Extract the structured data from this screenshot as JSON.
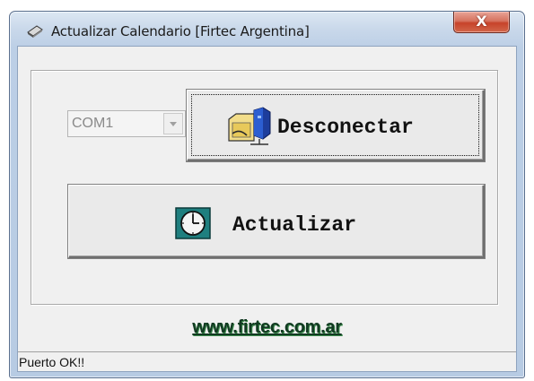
{
  "window": {
    "title": "Actualizar Calendario [Firtec Argentina]",
    "close_glyph": "X"
  },
  "port": {
    "selected": "COM1"
  },
  "buttons": {
    "disconnect_label": "Desconectar",
    "disconnect_icon": "network-computer-icon",
    "update_label": "Actualizar",
    "update_icon": "clock-icon"
  },
  "link": {
    "text": "www.firtec.com.ar"
  },
  "status": {
    "text": "Puerto OK!!"
  },
  "colors": {
    "link_text": "#123a22",
    "close_button": "#c7432a",
    "clock_face_bg": "#1f7f7f"
  }
}
